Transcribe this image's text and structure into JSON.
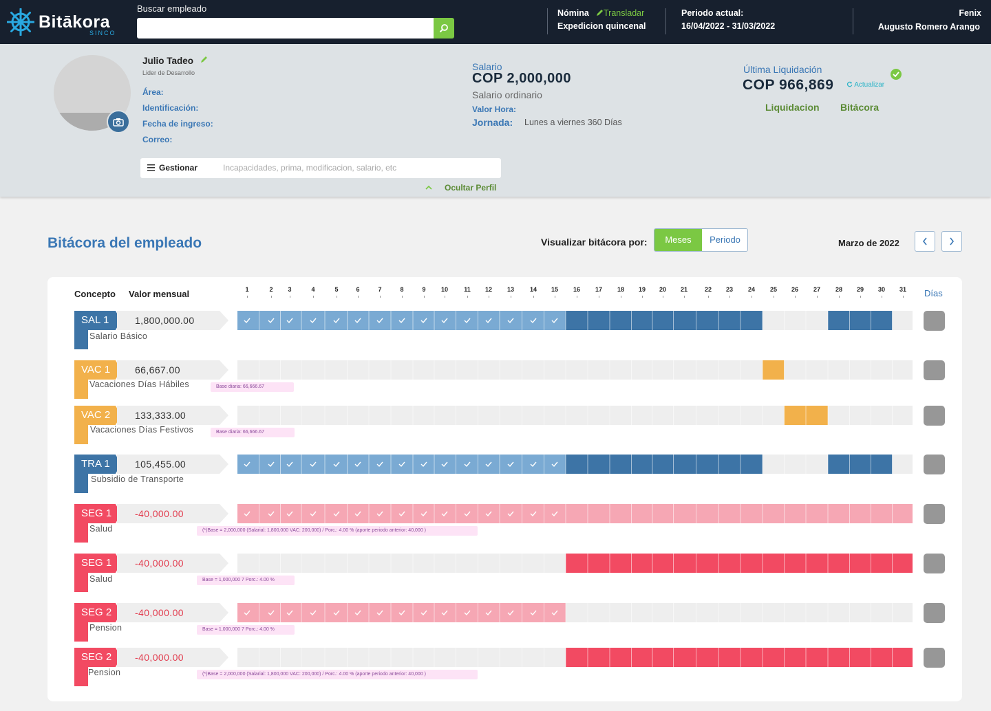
{
  "topbar": {
    "logo_text": "Bitākora",
    "logo_sub": "SINCO",
    "search_label": "Buscar empleado",
    "search_value": "",
    "nomina_label": "Nómina",
    "translate_link": "Transladar",
    "nomina_value": "Expedicion quincenal",
    "period_label": "Periodo actual:",
    "period_value": "16/04/2022 - 31/03/2022",
    "company": "Fenix",
    "user": "Augusto Romero Arango"
  },
  "profile": {
    "name": "Julio Tadeo",
    "role": "Lider de Desarrollo",
    "area_label": "Área:",
    "id_label": "Identificación:",
    "hire_label": "Fecha de ingreso:",
    "email_label": "Correo:",
    "manage_label": "Gestionar",
    "manage_placeholder": "Incapacidades, prima, modificacion, salario, etc",
    "hide_profile": "Ocultar Perfil",
    "salary_label": "Salario",
    "salary_value": "COP 2,000,000",
    "salary_type": "Salario ordinario",
    "hour_value_label": "Valor Hora:",
    "workday_label": "Jornada:",
    "workday_value": "Lunes a viernes 360 Días",
    "last_liq_label": "Última Liquidación",
    "last_liq_value": "COP 966,869",
    "update_link": "Actualizar",
    "liq_link": "Liquidacion",
    "log_link": "Bitácora"
  },
  "section": {
    "title": "Bitácora del empleado",
    "view_by_label": "Visualizar bitácora por:",
    "toggle_months": "Meses",
    "toggle_period": "Periodo",
    "current_month": "Marzo de 2022"
  },
  "table": {
    "concept_header": "Concepto",
    "value_header": "Valor mensual",
    "days_header": "Días",
    "days": [
      "1",
      "2",
      "3",
      "4",
      "5",
      "6",
      "7",
      "8",
      "9",
      "10",
      "11",
      "12",
      "13",
      "14",
      "15",
      "16",
      "17",
      "18",
      "19",
      "20",
      "21",
      "22",
      "23",
      "24",
      "25",
      "26",
      "27",
      "28",
      "29",
      "30",
      "31"
    ]
  },
  "colors": {
    "blue": "#3d74a6",
    "blue_light": "#7aaad3",
    "orange": "#f2b14b",
    "red": "#f24a62",
    "pink": "#f6a7b4",
    "green": "#7bc843",
    "topbar": "#17202e"
  },
  "rows": [
    {
      "code": "SAL 1",
      "value": "1,800,000.00",
      "desc": "Salario Básico",
      "note": ""
    },
    {
      "code": "VAC 1",
      "value": "66,667.00",
      "desc": "Vacaciones Días Hábiles",
      "note": "Base diaria: 66,666.67"
    },
    {
      "code": "VAC 2",
      "value": "133,333.00",
      "desc": "Vacaciones Días Festivos",
      "note": "Base diaria: 66,666.67"
    },
    {
      "code": "TRA 1",
      "value": "105,455.00",
      "desc": "Subsidio de Transporte",
      "note": ""
    },
    {
      "code": "SEG 1",
      "value": "-40,000.00",
      "desc": "Salud",
      "note": "(*)Base = 2,000,000 (Salarial: 1,800,000 VAC: 200,000) / Porc.: 4.00 % (aporte periodo anterior: 40,000 )"
    },
    {
      "code": "SEG 1",
      "value": "-40,000.00",
      "desc": "Salud",
      "note": "Base = 1,000,000 7 Porc.: 4.00 %"
    },
    {
      "code": "SEG 2",
      "value": "-40,000.00",
      "desc": "Pension",
      "note": "Base = 1,000,000 7 Porc.: 4.00 %"
    },
    {
      "code": "SEG 2",
      "value": "-40,000.00",
      "desc": "Pension",
      "note": "(*)Base = 2,000,000 (Salarial: 1,800,000 VAC: 200,000) / Porc.: 4.00 % (aporte periodo anterior: 40,000 )"
    }
  ]
}
